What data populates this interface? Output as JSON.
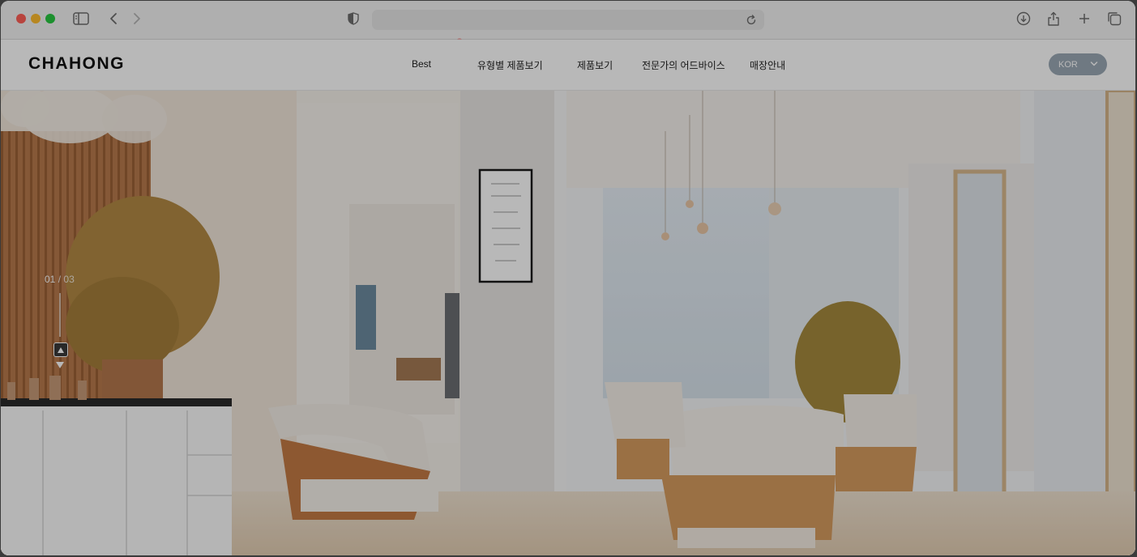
{
  "browser": {
    "url": "",
    "icons": [
      "sidebar-icon",
      "back-icon",
      "forward-icon",
      "shield-icon",
      "reload-icon",
      "download-icon",
      "share-icon",
      "new-tab-icon",
      "tabs-overview-icon"
    ]
  },
  "site": {
    "logo": "CHAHONG",
    "nav": [
      {
        "label": "Best"
      },
      {
        "label": "유형별 제품보기"
      },
      {
        "label": "제품보기"
      },
      {
        "label": "전문가의 어드바이스"
      },
      {
        "label": "매장안내"
      }
    ],
    "language": "KOR"
  },
  "hero": {
    "current": "01",
    "separator": "/",
    "total": "03"
  },
  "colors": {
    "accent": "#9aa8b5",
    "overlay": "rgba(0,0,0,0.28)"
  }
}
